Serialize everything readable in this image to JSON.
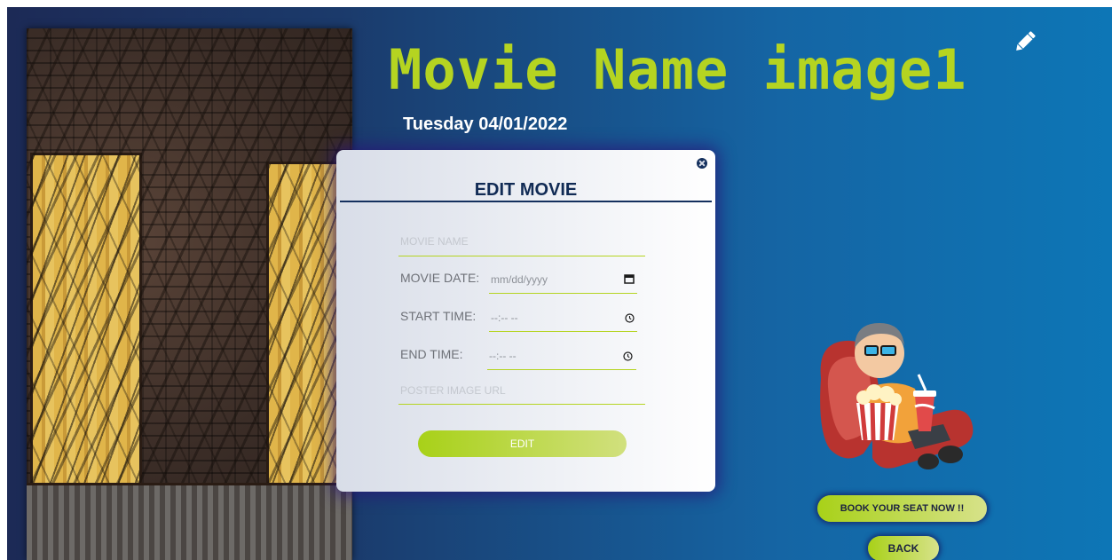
{
  "movie": {
    "title": "Movie Name image1",
    "date": "Tuesday 04/01/2022"
  },
  "modal": {
    "title": "EDIT MOVIE",
    "name_placeholder": "MOVIE NAME",
    "date_label": "MOVIE DATE:",
    "date_value": "mm/dd/yyyy",
    "start_label": "START TIME:",
    "start_value": "--:-- --",
    "end_label": "END TIME:",
    "end_value": "--:-- --",
    "poster_placeholder": "POSTER IMAGE URL",
    "submit_label": "EDIT"
  },
  "actions": {
    "book_label": "BOOK YOUR SEAT NOW !!",
    "back_label": "BACK"
  },
  "colors": {
    "accent": "#b5d421",
    "navy": "#112b55"
  },
  "icons": {
    "edit": "pencil-icon",
    "close": "close-icon",
    "calendar": "calendar-icon",
    "clock": "clock-icon"
  }
}
